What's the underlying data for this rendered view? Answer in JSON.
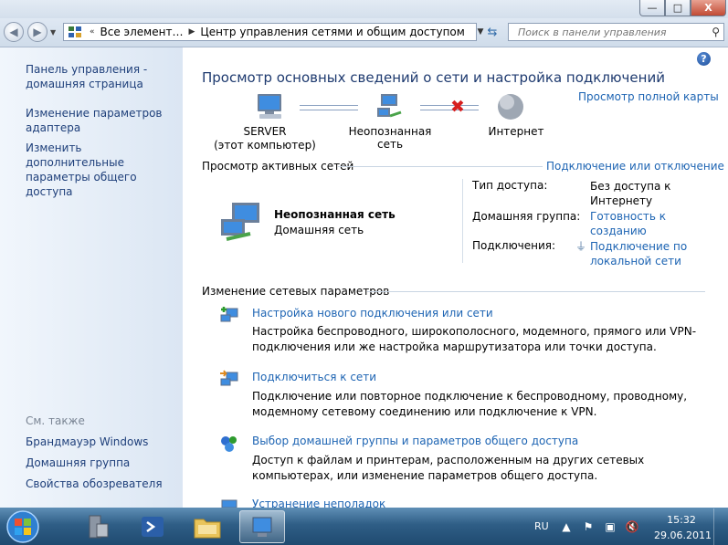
{
  "window": {
    "minimize_label": "—",
    "maximize_label": "□",
    "close_label": "X"
  },
  "nav": {
    "breadcrumb": [
      "Все элемент…",
      "Центр управления сетями и общим доступом"
    ],
    "search_placeholder": "Поиск в панели управления"
  },
  "sidebar": {
    "links": [
      "Панель управления - домашняя страница",
      "Изменение параметров адаптера",
      "Изменить дополнительные параметры общего доступа"
    ],
    "see_also_label": "См. также",
    "see_also": [
      "Брандмауэр Windows",
      "Домашняя группа",
      "Свойства обозревателя"
    ]
  },
  "main": {
    "title": "Просмотр основных сведений о сети и настройка подключений",
    "full_map_link": "Просмотр полной карты",
    "map": {
      "computer_name": "SERVER",
      "computer_sub": "(этот компьютер)",
      "network_name": "Неопознанная сеть",
      "internet": "Интернет"
    },
    "active_networks": {
      "heading": "Просмотр активных сетей",
      "connect_link": "Подключение или отключение",
      "network_name": "Неопознанная сеть",
      "network_type": "Домашняя сеть",
      "access_type_label": "Тип доступа:",
      "access_type_value": "Без доступа к Интернету",
      "homegroup_label": "Домашняя группа:",
      "homegroup_value": "Готовность к созданию",
      "connections_label": "Подключения:",
      "connections_value": "Подключение по локальной сети"
    },
    "change_settings": {
      "heading": "Изменение сетевых параметров",
      "tasks": [
        {
          "title": "Настройка нового подключения или сети",
          "desc": "Настройка беспроводного, широкополосного, модемного, прямого или VPN-подключения или же настройка маршрутизатора или точки доступа."
        },
        {
          "title": "Подключиться к сети",
          "desc": "Подключение или повторное подключение к беспроводному, проводному, модемному сетевому соединению или подключение к VPN."
        },
        {
          "title": "Выбор домашней группы и параметров общего доступа",
          "desc": "Доступ к файлам и принтерам, расположенным на других сетевых компьютерах, или изменение параметров общего доступа."
        },
        {
          "title": "Устранение неполадок",
          "desc": ""
        }
      ]
    }
  },
  "taskbar": {
    "language": "RU",
    "time": "15:32",
    "date": "29.06.2011"
  }
}
